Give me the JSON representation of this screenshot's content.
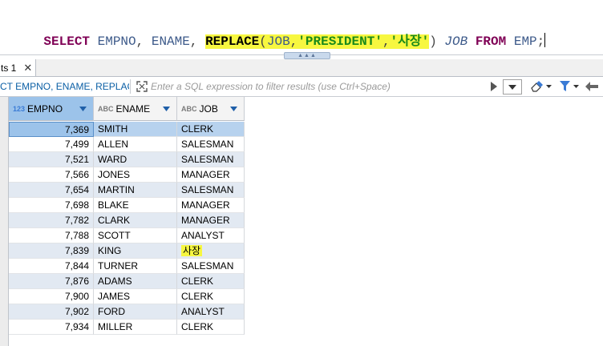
{
  "editor": {
    "sql_tokens": [
      {
        "t": "SELECT",
        "c": "kw"
      },
      {
        "t": " ",
        "c": "pn"
      },
      {
        "t": "EMPNO",
        "c": "id"
      },
      {
        "t": ", ",
        "c": "pn"
      },
      {
        "t": "ENAME",
        "c": "id"
      },
      {
        "t": ", ",
        "c": "pn"
      },
      {
        "t": "REPLACE",
        "c": "fn",
        "hl": true
      },
      {
        "t": "(",
        "c": "pn",
        "hl": true
      },
      {
        "t": "JOB",
        "c": "id",
        "hl": true
      },
      {
        "t": ",",
        "c": "pn",
        "hl": true
      },
      {
        "t": "'PRESIDENT'",
        "c": "str",
        "hl": true
      },
      {
        "t": ",",
        "c": "pn",
        "hl": true
      },
      {
        "t": "'사장'",
        "c": "str",
        "hl": true
      },
      {
        "t": ") ",
        "c": "pn"
      },
      {
        "t": "JOB",
        "c": "alias"
      },
      {
        "t": " ",
        "c": "pn"
      },
      {
        "t": "FROM",
        "c": "kw"
      },
      {
        "t": " ",
        "c": "pn"
      },
      {
        "t": "EMP",
        "c": "id"
      },
      {
        "t": ";",
        "c": "pn"
      }
    ],
    "highlight_color": "#f7f740"
  },
  "results_tab": {
    "label": "ts 1"
  },
  "filter_bar": {
    "query_text": "CT EMPNO, ENAME, REPLACE(",
    "filter_placeholder": "Enter a SQL expression to filter results (use Ctrl+Space)",
    "icons": [
      "expand-icon",
      "run-filter-icon",
      "filter-history-icon",
      "eraser-icon",
      "funnel-icon",
      "back-arrow-icon"
    ]
  },
  "grid": {
    "columns": [
      {
        "type_label": "123",
        "name": "EMPNO",
        "selected": true
      },
      {
        "type_label": "ABC",
        "name": "ENAME",
        "selected": false
      },
      {
        "type_label": "ABC",
        "name": "JOB",
        "selected": false
      }
    ],
    "rows": [
      {
        "empno": "7,369",
        "ename": "SMITH",
        "job": "CLERK"
      },
      {
        "empno": "7,499",
        "ename": "ALLEN",
        "job": "SALESMAN"
      },
      {
        "empno": "7,521",
        "ename": "WARD",
        "job": "SALESMAN"
      },
      {
        "empno": "7,566",
        "ename": "JONES",
        "job": "MANAGER"
      },
      {
        "empno": "7,654",
        "ename": "MARTIN",
        "job": "SALESMAN"
      },
      {
        "empno": "7,698",
        "ename": "BLAKE",
        "job": "MANAGER"
      },
      {
        "empno": "7,782",
        "ename": "CLARK",
        "job": "MANAGER"
      },
      {
        "empno": "7,788",
        "ename": "SCOTT",
        "job": "ANALYST"
      },
      {
        "empno": "7,839",
        "ename": "KING",
        "job": "사장",
        "highlight_job": true
      },
      {
        "empno": "7,844",
        "ename": "TURNER",
        "job": "SALESMAN"
      },
      {
        "empno": "7,876",
        "ename": "ADAMS",
        "job": "CLERK"
      },
      {
        "empno": "7,900",
        "ename": "JAMES",
        "job": "CLERK"
      },
      {
        "empno": "7,902",
        "ename": "FORD",
        "job": "ANALYST"
      },
      {
        "empno": "7,934",
        "ename": "MILLER",
        "job": "CLERK"
      }
    ],
    "selected_row_index": 0
  },
  "colors": {
    "accent_blue": "#3a7bd5",
    "selected_header": "#9cc3ea",
    "alt_row": "#e2e9f2",
    "keyword": "#7f0055",
    "string": "#1a8a1a"
  }
}
